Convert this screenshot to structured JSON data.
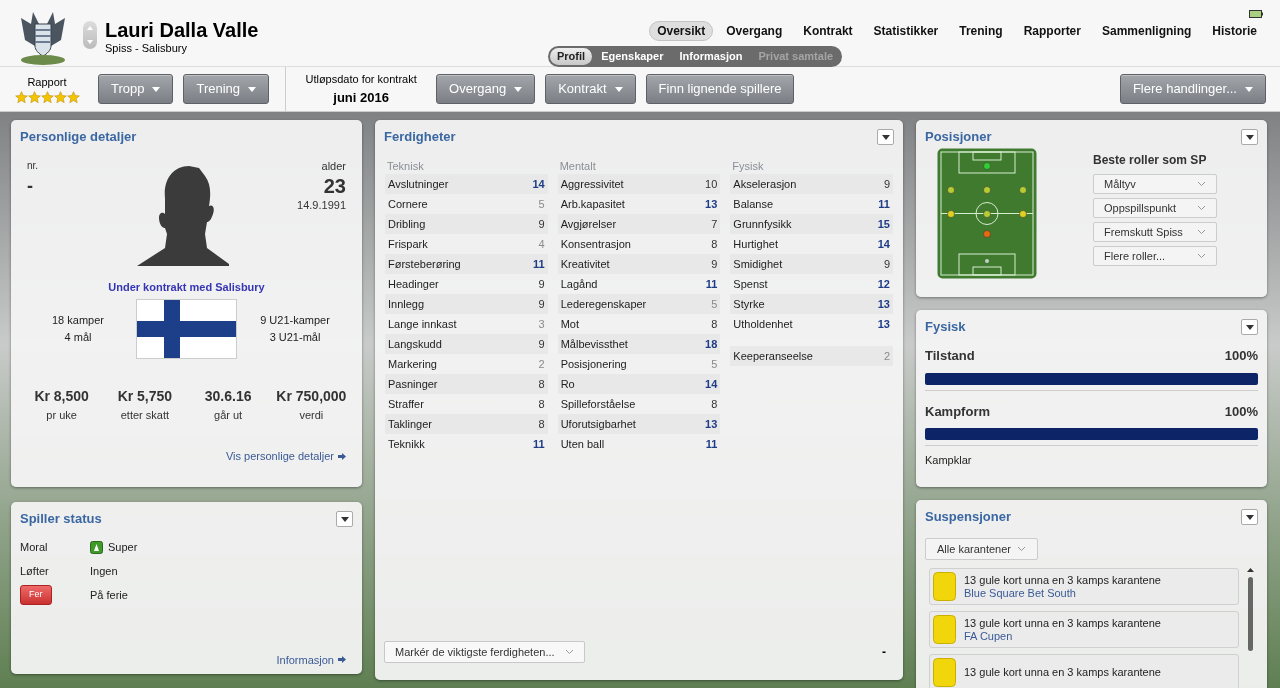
{
  "header": {
    "name": "Lauri Dalla Valle",
    "subtitle": "Spiss - Salisbury",
    "tabs": [
      {
        "label": "Oversikt",
        "selected": true
      },
      {
        "label": "Overgang",
        "selected": false
      },
      {
        "label": "Kontrakt",
        "selected": false
      },
      {
        "label": "Statistikker",
        "selected": false
      },
      {
        "label": "Trening",
        "selected": false
      },
      {
        "label": "Rapporter",
        "selected": false
      },
      {
        "label": "Sammenligning",
        "selected": false
      },
      {
        "label": "Historie",
        "selected": false
      }
    ],
    "subtabs": [
      {
        "label": "Profil",
        "selected": true,
        "disabled": false
      },
      {
        "label": "Egenskaper",
        "selected": false,
        "disabled": false
      },
      {
        "label": "Informasjon",
        "selected": false,
        "disabled": false
      },
      {
        "label": "Privat samtale",
        "selected": false,
        "disabled": true
      }
    ]
  },
  "toolbar": {
    "report": {
      "label": "Rapport",
      "stars": 5
    },
    "buttons_left": [
      "Tropp",
      "Trening"
    ],
    "contract": {
      "label": "Utløpsdato for kontrakt",
      "value": "juni 2016"
    },
    "buttons_right": [
      "Overgang",
      "Kontrakt"
    ],
    "similar_button": "Finn lignende spillere",
    "more_button": "Flere handlinger..."
  },
  "personal": {
    "title": "Personlige detaljer",
    "number_label": "nr.",
    "number": "-",
    "age_label": "alder",
    "age": "23",
    "birth_date": "14.9.1991",
    "contract_status": "Under kontrakt med Salisbury",
    "caps": [
      "18 kamper",
      "4 mål"
    ],
    "u21": [
      "9 U21-kamper",
      "3 U21-mål"
    ],
    "figures": [
      {
        "value": "Kr 8,500",
        "label": "pr uke"
      },
      {
        "value": "Kr 5,750",
        "label": "etter skatt"
      },
      {
        "value": "30.6.16",
        "label": "går ut"
      },
      {
        "value": "Kr 750,000",
        "label": "verdi"
      }
    ],
    "link": "Vis personlige detaljer"
  },
  "status": {
    "title": "Spiller status",
    "rows": [
      {
        "kind": "icon",
        "label": "Moral",
        "value": "Super"
      },
      {
        "kind": "text",
        "label": "Løfter",
        "value": "Ingen"
      },
      {
        "kind": "badge",
        "label": "Fer",
        "value": "På ferie"
      }
    ],
    "link": "Informasjon"
  },
  "skills": {
    "title": "Ferdigheter",
    "columns": [
      {
        "heading": "Teknisk",
        "rows": [
          {
            "name": "Avslutninger",
            "value": "14"
          },
          {
            "name": "Cornere",
            "value": "5"
          },
          {
            "name": "Dribling",
            "value": "9"
          },
          {
            "name": "Frispark",
            "value": "4"
          },
          {
            "name": "Førsteberøring",
            "value": "11"
          },
          {
            "name": "Headinger",
            "value": "9"
          },
          {
            "name": "Innlegg",
            "value": "9"
          },
          {
            "name": "Lange innkast",
            "value": "3"
          },
          {
            "name": "Langskudd",
            "value": "9"
          },
          {
            "name": "Markering",
            "value": "2"
          },
          {
            "name": "Pasninger",
            "value": "8"
          },
          {
            "name": "Straffer",
            "value": "8"
          },
          {
            "name": "Taklinger",
            "value": "8"
          },
          {
            "name": "Teknikk",
            "value": "11"
          }
        ]
      },
      {
        "heading": "Mentalt",
        "rows": [
          {
            "name": "Aggressivitet",
            "value": "10"
          },
          {
            "name": "Arb.kapasitet",
            "value": "13"
          },
          {
            "name": "Avgjørelser",
            "value": "7"
          },
          {
            "name": "Konsentrasjon",
            "value": "8"
          },
          {
            "name": "Kreativitet",
            "value": "9"
          },
          {
            "name": "Lagånd",
            "value": "11"
          },
          {
            "name": "Lederegenskaper",
            "value": "5"
          },
          {
            "name": "Mot",
            "value": "8"
          },
          {
            "name": "Målbevissthet",
            "value": "18"
          },
          {
            "name": "Posisjonering",
            "value": "5"
          },
          {
            "name": "Ro",
            "value": "14"
          },
          {
            "name": "Spilleforståelse",
            "value": "8"
          },
          {
            "name": "Uforutsigbarhet",
            "value": "13"
          },
          {
            "name": "Uten ball",
            "value": "11"
          }
        ]
      },
      {
        "heading": "Fysisk",
        "rows": [
          {
            "name": "Akselerasjon",
            "value": "9"
          },
          {
            "name": "Balanse",
            "value": "11"
          },
          {
            "name": "Grunnfysikk",
            "value": "15"
          },
          {
            "name": "Hurtighet",
            "value": "14"
          },
          {
            "name": "Smidighet",
            "value": "9"
          },
          {
            "name": "Spenst",
            "value": "12"
          },
          {
            "name": "Styrke",
            "value": "13"
          },
          {
            "name": "Utholdenhet",
            "value": "13"
          }
        ],
        "extra_rows": [
          {
            "name": "Keeperanseelse",
            "value": "2"
          }
        ]
      }
    ],
    "highlight_button": "Markér de viktigste ferdigheten...",
    "footer_mark": "-"
  },
  "positions": {
    "title": "Posisjoner",
    "roles_title": "Beste roller som SP",
    "roles": [
      "Måltyv",
      "Oppspillspunkt",
      "Fremskutt Spiss",
      "Flere roller..."
    ]
  },
  "physical": {
    "title": "Fysisk",
    "meters": [
      {
        "label": "Tilstand",
        "reading": "100%",
        "level": 1
      },
      {
        "label": "Kampform",
        "reading": "100%",
        "level": 1
      }
    ],
    "status": "Kampklar"
  },
  "suspensions": {
    "title": "Suspensjoner",
    "filter": "Alle karantener",
    "items": [
      {
        "text": "13 gule kort unna en 3 kamps karantene",
        "competition": "Blue Square Bet South"
      },
      {
        "text": "13 gule kort unna en 3 kamps karantene",
        "competition": "FA Cupen"
      },
      {
        "text": "13 gule kort unna en 3 kamps karantene"
      }
    ]
  }
}
